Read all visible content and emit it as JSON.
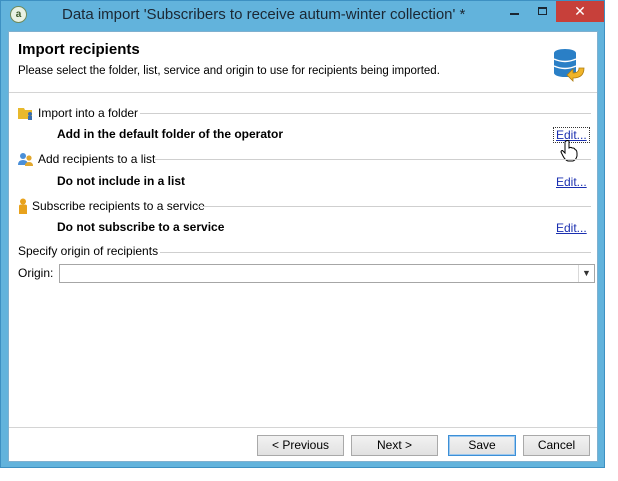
{
  "window": {
    "title": "Data import 'Subscribers to receive autum-winter collection' *",
    "app_icon": "adobe-campaign-icon",
    "close_glyph": "✕"
  },
  "header": {
    "title": "Import recipients",
    "subtitle": "Please select the folder, list, service and origin to use for recipients being imported.",
    "icon": "database-import-icon"
  },
  "sections": [
    {
      "label": "Import into a folder",
      "value": "Add in the default folder of the operator",
      "edit": "Edit...",
      "icon": "folder-user-icon"
    },
    {
      "label": "Add recipients to a list",
      "value": "Do not include in a list",
      "edit": "Edit...",
      "icon": "users-list-icon"
    },
    {
      "label": "Subscribe recipients to a service",
      "value": "Do not subscribe to a service",
      "edit": "Edit...",
      "icon": "subscriber-icon"
    }
  ],
  "origin": {
    "group_label": "Specify origin of recipients",
    "label": "Origin:",
    "value": ""
  },
  "buttons": {
    "previous": "< Previous",
    "next": "Next >",
    "save": "Save",
    "cancel": "Cancel"
  },
  "colors": {
    "titlebar": "#62b3dc",
    "close": "#c7403a",
    "link": "#1a2fb0",
    "default_button_border": "#3c8fd6"
  }
}
